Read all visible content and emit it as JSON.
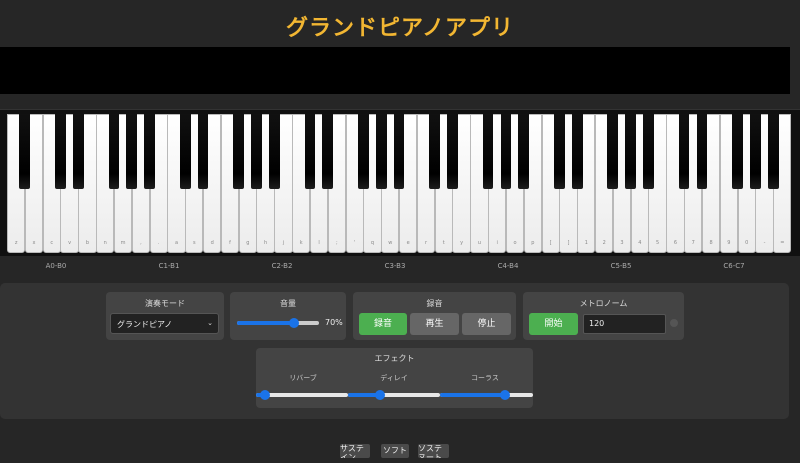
{
  "app": {
    "title": "グランドピアノアプリ"
  },
  "piano": {
    "white_key_labels": [
      "z",
      "x",
      "c",
      "v",
      "b",
      "n",
      "m",
      ",",
      ".",
      "a",
      "s",
      "d",
      "f",
      "g",
      "h",
      "j",
      "k",
      "l",
      ";",
      "'",
      "q",
      "w",
      "e",
      "r",
      "t",
      "y",
      "u",
      "i",
      "o",
      "p",
      "[",
      "]",
      "1",
      "2",
      "3",
      "4",
      "5",
      "6",
      "7",
      "8",
      "9",
      "0",
      "-",
      "="
    ],
    "octave_labels": [
      "A0-B0",
      "C1-B1",
      "C2-B2",
      "C3-B3",
      "C4-B4",
      "C5-B5",
      "C6-C7"
    ]
  },
  "controls": {
    "mode": {
      "title": "演奏モード",
      "selected": "グランドピアノ"
    },
    "volume": {
      "title": "音量",
      "value_text": "70%",
      "value": 0.7
    },
    "record": {
      "title": "録音",
      "record_label": "録音",
      "play_label": "再生",
      "stop_label": "停止"
    },
    "metronome": {
      "title": "メトロノーム",
      "start_label": "開始",
      "bpm": "120"
    },
    "effects": {
      "title": "エフェクト",
      "reverb_label": "リバーブ",
      "reverb_value": 0.1,
      "delay_label": "ディレイ",
      "delay_value": 0.35,
      "chorus_label": "コーラス",
      "chorus_value": 0.7
    }
  },
  "pedals": {
    "sustain": "サステイン",
    "soft": "ソフト",
    "sostenuto": "ソステヌート"
  },
  "colors": {
    "accent": "#f2b632",
    "record_green": "#4caf50",
    "slider_blue": "#1a73e8"
  }
}
